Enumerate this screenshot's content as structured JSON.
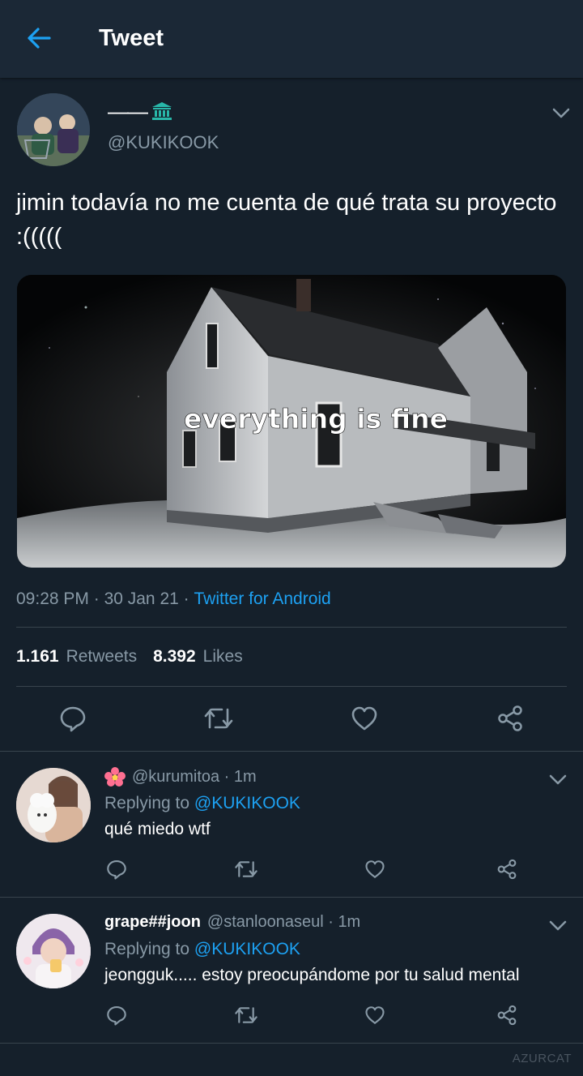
{
  "header": {
    "title": "Tweet"
  },
  "tweet": {
    "display_name": "——",
    "handle": "@KUKIKOOK",
    "text": "jimin todavía no me cuenta de qué trata su proyecto :(((((",
    "media_caption": "everything is fine",
    "time": "09:28 PM",
    "date": "30 Jan 21",
    "source": "Twitter for Android",
    "retweets_count": "1.161",
    "retweets_label": "Retweets",
    "likes_count": "8.392",
    "likes_label": "Likes"
  },
  "replies": [
    {
      "name": "",
      "handle": "@kurumitoa",
      "time": "1m",
      "replying_prefix": "Replying to",
      "replying_to": "@KUKIKOOK",
      "text": "qué miedo wtf"
    },
    {
      "name": "grape##joon",
      "handle": "@stanloonaseul",
      "time": "1m",
      "replying_prefix": "Replying to",
      "replying_to": "@KUKIKOOK",
      "text": "jeongguk..... estoy preocupándome por tu salud mental"
    }
  ],
  "watermark": "AZURCAT",
  "icons": {
    "back": "arrow-left-icon",
    "verified": "bank-icon",
    "more": "chevron-down-icon",
    "reply": "comment-icon",
    "retweet": "retweet-icon",
    "like": "heart-icon",
    "share": "share-icon",
    "flower": "flower-icon"
  },
  "colors": {
    "background": "#15202b",
    "header": "#1b2836",
    "accent": "#1da1f2",
    "secondary_text": "#8899a6",
    "divider": "#38444d"
  }
}
